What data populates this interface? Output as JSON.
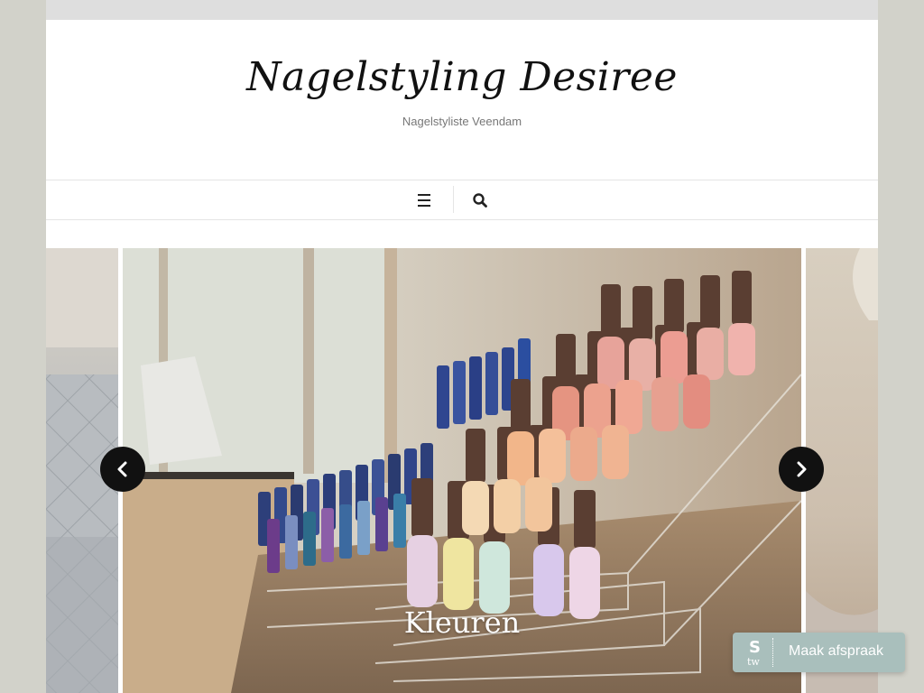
{
  "site": {
    "title": "Nagelstyling Desiree",
    "tagline": "Nagelstyliste Veendam"
  },
  "nav": {
    "menu_icon": "hamburger-icon",
    "search_icon": "search-icon"
  },
  "slider": {
    "caption": "Kleuren",
    "prev_icon": "chevron-left-icon",
    "next_icon": "chevron-right-icon"
  },
  "booking_widget": {
    "logo_text": "tw",
    "logo_symbol": "S",
    "label": "Maak afspraak",
    "background": "#a9bfbc"
  },
  "colors": {
    "page_background": "#d2d2ca",
    "content_background": "#ffffff",
    "arrow_background": "#111111"
  }
}
